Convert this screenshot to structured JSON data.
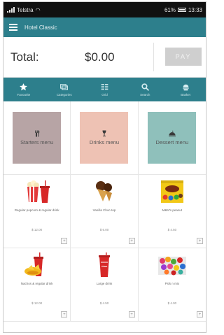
{
  "status": {
    "carrier": "Telstra",
    "battery_pct": "61%",
    "time": "13:33"
  },
  "appbar": {
    "title": "Hotel Classic"
  },
  "totals": {
    "label": "Total:",
    "amount": "$0.00",
    "pay_label": "PAY"
  },
  "tabs": [
    {
      "label": "Favourite",
      "icon": "star-icon",
      "active": true
    },
    {
      "label": "Categories",
      "icon": "categories-icon"
    },
    {
      "label": "Grid",
      "icon": "grid-icon"
    },
    {
      "label": "Search",
      "icon": "search-icon"
    },
    {
      "label": "Basket",
      "icon": "basket-icon"
    }
  ],
  "menus": [
    {
      "label": "Starters menu",
      "icon": "cutlery-icon",
      "color": "#b7a4a5"
    },
    {
      "label": "Drinks menu",
      "icon": "wine-glass-icon",
      "color": "#eec2b4"
    },
    {
      "label": "Dessert menu",
      "icon": "cloche-icon",
      "color": "#8fc0bb"
    }
  ],
  "products": [
    {
      "name": "Regular popcorn & regular drink",
      "price": "$ 12.00"
    },
    {
      "name": "Vanilla Choc-top",
      "price": "$ 6.00"
    },
    {
      "name": "M&M's peanut",
      "price": "$ 4.50"
    },
    {
      "name": "Nachos & regular drink",
      "price": "$ 12.00"
    },
    {
      "name": "Large drink",
      "price": "$ 4.50"
    },
    {
      "name": "Pick n mix",
      "price": "$ 4.00"
    }
  ],
  "colors": {
    "primary": "#2d7f8c",
    "pay_disabled": "#cfcfcf"
  }
}
